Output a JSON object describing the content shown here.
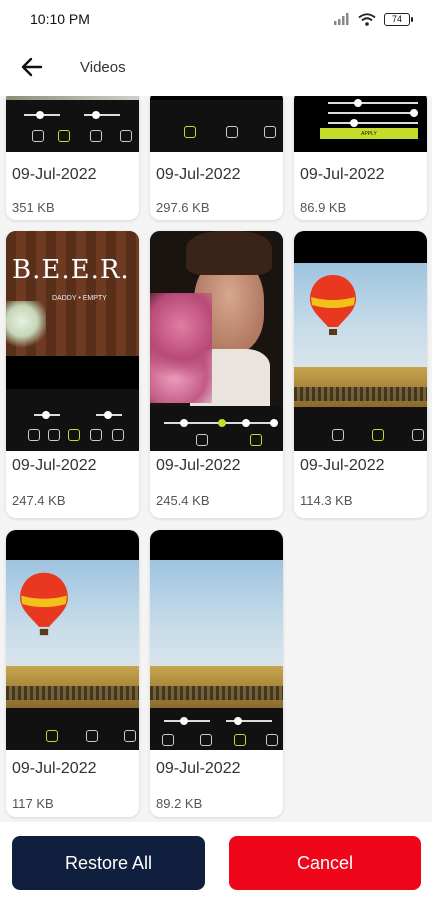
{
  "status_bar": {
    "time": "10:10 PM",
    "battery": "74"
  },
  "header": {
    "title": "Videos",
    "back_icon": "arrow-left-icon"
  },
  "items": [
    {
      "date": "09-Jul-2022",
      "size": "351 KB"
    },
    {
      "date": "09-Jul-2022",
      "size": "297.6 KB"
    },
    {
      "date": "09-Jul-2022",
      "size": "86.9 KB"
    },
    {
      "date": "09-Jul-2022",
      "size": "247.4 KB"
    },
    {
      "date": "09-Jul-2022",
      "size": "245.4 KB"
    },
    {
      "date": "09-Jul-2022",
      "size": "114.3 KB"
    },
    {
      "date": "09-Jul-2022",
      "size": "117 KB"
    },
    {
      "date": "09-Jul-2022",
      "size": "89.2 KB"
    }
  ],
  "thumb_text": {
    "beer_title": "B.E.E.R.",
    "beer_subtitle": "DADDY • EMPTY",
    "apply": "APPLY"
  },
  "actions": {
    "restore_label": "Restore All",
    "cancel_label": "Cancel"
  },
  "colors": {
    "primary": "#0f1f3d",
    "danger": "#f0061a",
    "accent": "#c7dc2a"
  }
}
